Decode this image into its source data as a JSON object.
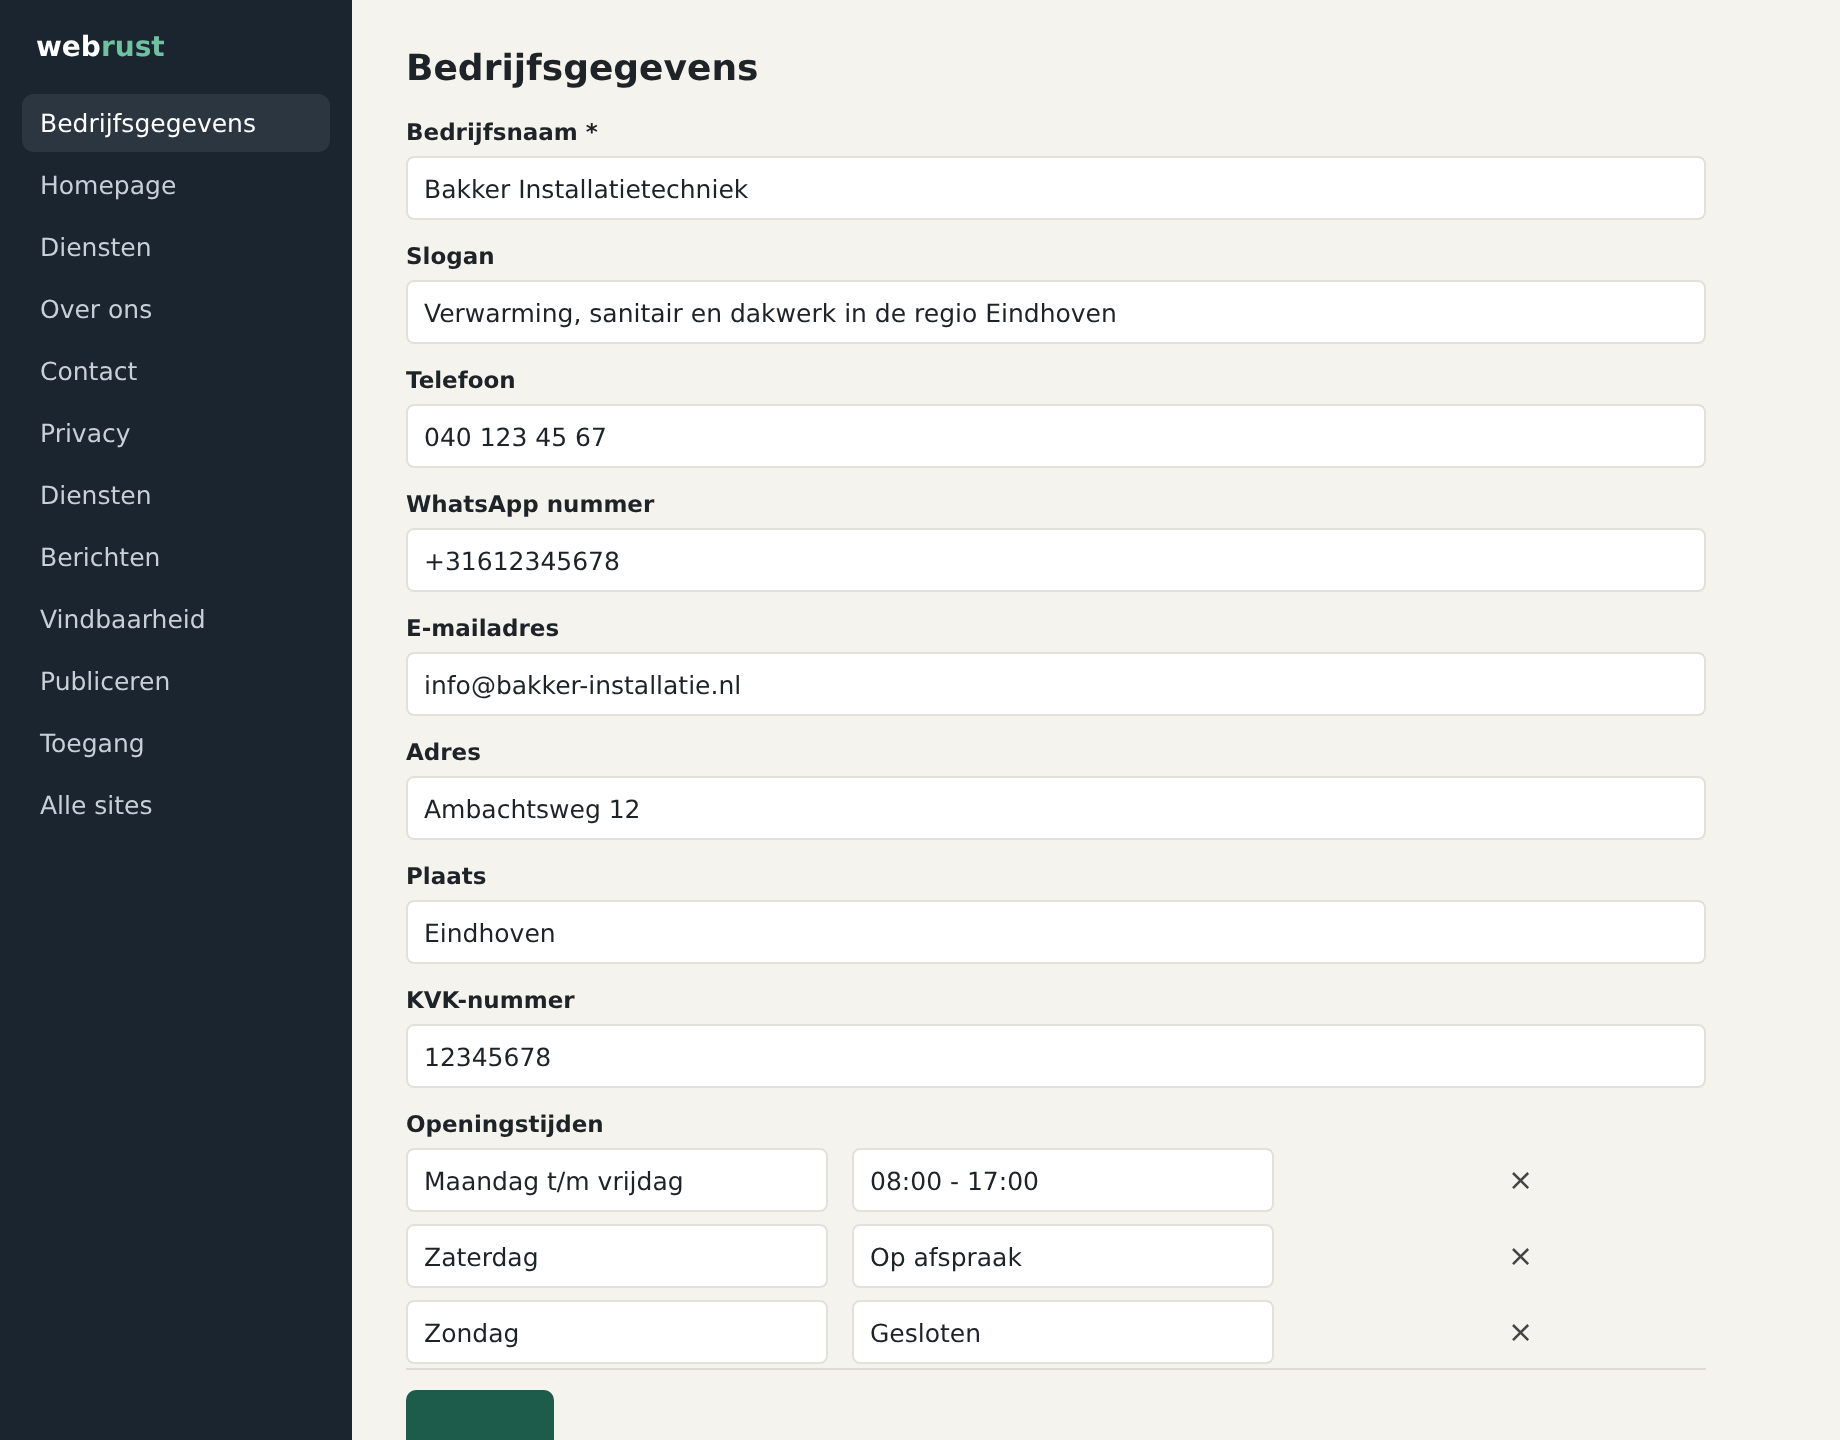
{
  "logo": {
    "prefix": "web",
    "accent": "rust"
  },
  "sidebar": {
    "items": [
      {
        "label": "Bedrijfsgegevens",
        "selected": true
      },
      {
        "label": "Homepage",
        "selected": false
      },
      {
        "label": "Diensten",
        "selected": false
      },
      {
        "label": "Over ons",
        "selected": false
      },
      {
        "label": "Contact",
        "selected": false
      },
      {
        "label": "Privacy",
        "selected": false
      },
      {
        "label": "Diensten",
        "selected": false
      },
      {
        "label": "Berichten",
        "selected": false
      },
      {
        "label": "Vindbaarheid",
        "selected": false
      },
      {
        "label": "Publiceren",
        "selected": false
      },
      {
        "label": "Toegang",
        "selected": false
      },
      {
        "label": "Alle sites",
        "selected": false
      }
    ]
  },
  "title": "Bedrijfsgegevens",
  "fields": [
    {
      "label": "Bedrijfsnaam *",
      "value": "Bakker Installatietechniek"
    },
    {
      "label": "Slogan",
      "value": "Verwarming, sanitair en dakwerk in de regio Eindhoven"
    },
    {
      "label": "Telefoon",
      "value": "040 123 45 67"
    },
    {
      "label": "WhatsApp nummer",
      "value": "+31612345678"
    },
    {
      "label": "E-mailadres",
      "value": "info@bakker-installatie.nl"
    },
    {
      "label": "Adres",
      "value": "Ambachtsweg 12"
    },
    {
      "label": "Plaats",
      "value": "Eindhoven"
    },
    {
      "label": "KVK-nummer",
      "value": "12345678"
    }
  ],
  "opening_hours": {
    "label": "Openingstijden",
    "rows": [
      {
        "day": "Maandag t/m vrijdag",
        "hours": "08:00 - 17:00",
        "remove": "×"
      },
      {
        "day": "Zaterdag",
        "hours": "Op afspraak",
        "remove": "×"
      },
      {
        "day": "Zondag",
        "hours": "Gesloten",
        "remove": "×"
      }
    ]
  }
}
